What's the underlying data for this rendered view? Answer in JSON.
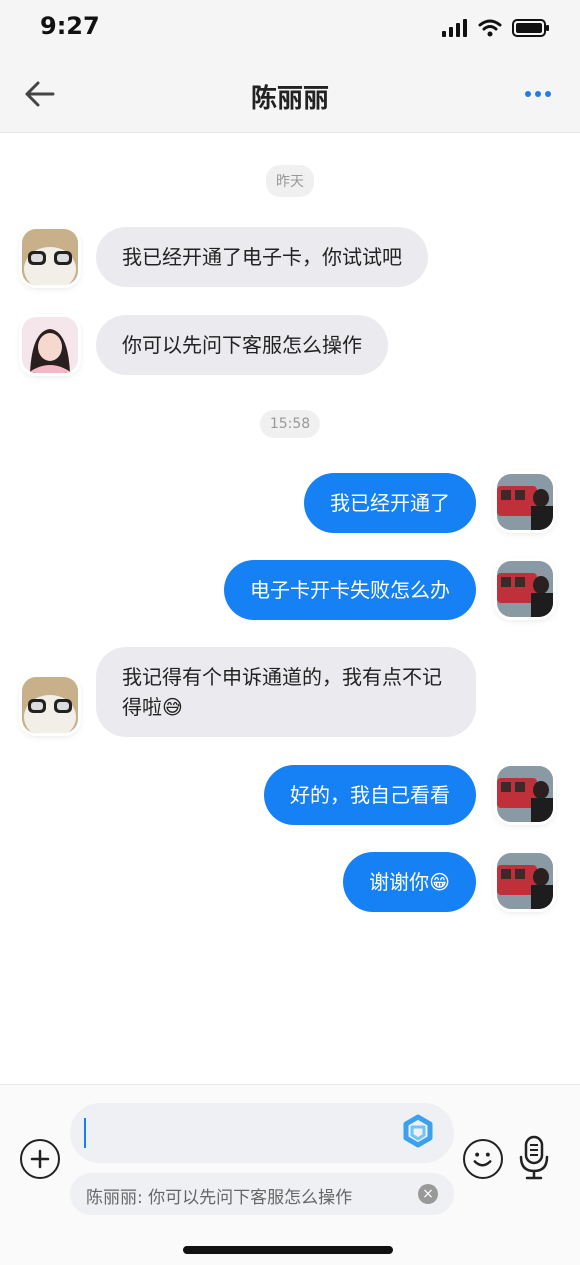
{
  "status_bar": {
    "time": "9:27"
  },
  "header": {
    "title": "陈丽丽"
  },
  "chat": {
    "timestamps": [
      "昨天",
      "15:58"
    ],
    "messages": [
      {
        "side": "in",
        "text": "我已经开通了电子卡，你试试吧",
        "avatar": "peer-avatar-glasses"
      },
      {
        "side": "in",
        "text": "你可以先问下客服怎么操作",
        "avatar": "peer-avatar-girl"
      },
      {
        "side": "out",
        "text": "我已经开通了",
        "avatar": "self-avatar"
      },
      {
        "side": "out",
        "text": "电子卡开卡失败怎么办",
        "avatar": "self-avatar"
      },
      {
        "side": "in",
        "text": "我记得有个申诉通道的，我有点不记得啦😅",
        "avatar": "peer-avatar-glasses"
      },
      {
        "side": "out",
        "text": "好的，我自己看看",
        "avatar": "self-avatar"
      },
      {
        "side": "out",
        "text": "谢谢你😁",
        "avatar": "self-avatar"
      }
    ]
  },
  "composer": {
    "input_value": "",
    "quote": "陈丽丽: 你可以先问下客服怎么操作"
  },
  "colors": {
    "accent": "#1681f4",
    "incoming_bubble": "#ebebef"
  },
  "icons": [
    "signal-icon",
    "wifi-icon",
    "battery-icon",
    "back-arrow-icon",
    "more-icon",
    "plus-icon",
    "ai-assistant-icon",
    "close-icon",
    "emoji-icon",
    "microphone-icon"
  ]
}
